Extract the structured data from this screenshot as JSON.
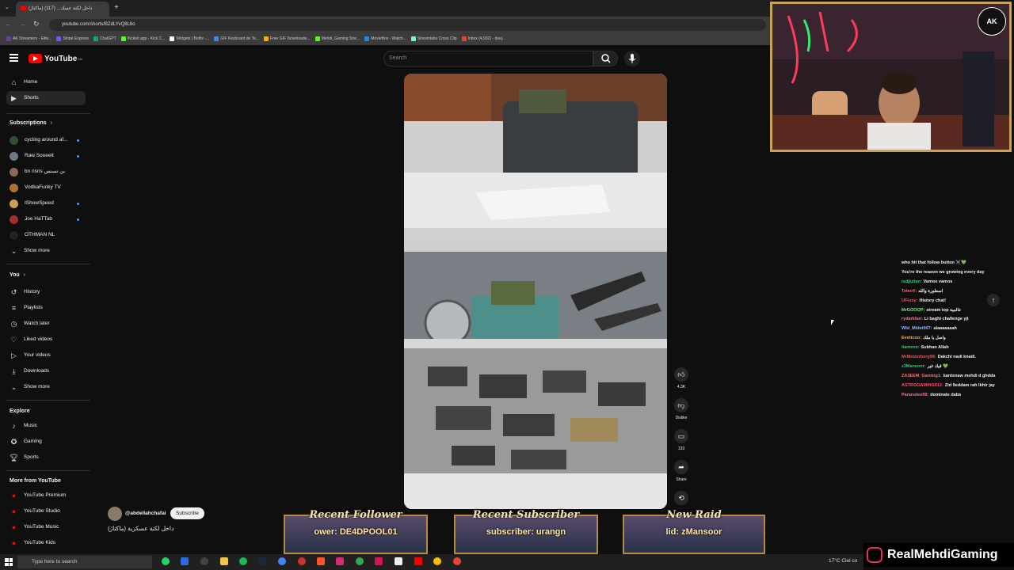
{
  "browser": {
    "tab_title": "(ماكتاژ) داخل لكتة عسك... (117)",
    "url": "youtube.com/shorts/BZdLYvQ8L6o",
    "bookmarks": [
      "AK Streamers - Elite...",
      "Stripe Express",
      "ChatGPT",
      "Kicklet.app - Kick C...",
      "Widgets | Botfix -...",
      "GIF Keyboard de Te...",
      "Free GIF Downloade...",
      "Mehdi_Gaming Stre...",
      "MovieBox - Watch...",
      "Streamlabs Cross Clip",
      "Inbox (4,932) - deej..."
    ],
    "bookmark_colors": [
      "#6b3fa0",
      "#635bff",
      "#10a37f",
      "#53fc18",
      "#ffffff",
      "#4285f4",
      "#f4b400",
      "#53fc18",
      "#1e88e5",
      "#80f5d2",
      "#ea4335"
    ]
  },
  "youtube": {
    "logo_text": "YouTube",
    "logo_sup": "MA",
    "search_placeholder": "Search",
    "sidebar": {
      "main": [
        {
          "label": "Home",
          "icon": "home-icon"
        },
        {
          "label": "Shorts",
          "icon": "shorts-icon"
        }
      ],
      "subscriptions_title": "Subscriptions",
      "subscriptions": [
        {
          "label": "cycling around af...",
          "color": "#2f4f2f",
          "dot": true
        },
        {
          "label": "Raw Soueeit",
          "color": "#6a7a8a",
          "dot": true
        },
        {
          "label": "bn nsns بن نسنس",
          "color": "#8a6a5a",
          "dot": false
        },
        {
          "label": "VodkaFunky TV",
          "color": "#b07030",
          "dot": false
        },
        {
          "label": "IShowSpeed",
          "color": "#c9a24a",
          "dot": true
        },
        {
          "label": "Joe HaTTab",
          "color": "#a03030",
          "dot": true
        },
        {
          "label": "OTHMAN NL",
          "color": "#222222",
          "dot": false
        }
      ],
      "show_more": "Show more",
      "you_title": "You",
      "you": [
        {
          "label": "History",
          "icon": "history-icon"
        },
        {
          "label": "Playlists",
          "icon": "playlists-icon"
        },
        {
          "label": "Watch later",
          "icon": "watch-later-icon"
        },
        {
          "label": "Liked videos",
          "icon": "liked-videos-icon"
        },
        {
          "label": "Your videos",
          "icon": "your-videos-icon"
        },
        {
          "label": "Downloads",
          "icon": "downloads-icon"
        }
      ],
      "show_more_2": "Show more",
      "explore_title": "Explore",
      "explore": [
        {
          "label": "Music",
          "icon": "music-icon"
        },
        {
          "label": "Gaming",
          "icon": "gaming-icon"
        },
        {
          "label": "Sports",
          "icon": "sports-icon"
        }
      ],
      "more_title": "More from YouTube",
      "more": [
        {
          "label": "YouTube Premium"
        },
        {
          "label": "YouTube Studio"
        },
        {
          "label": "YouTube Music"
        },
        {
          "label": "YouTube Kids"
        }
      ]
    },
    "short": {
      "channel": "@abdellahchafai",
      "subscribe": "Subscribe",
      "title": "(ماكتاژ) داخل لكتة عسكرية",
      "likes": "4.3K",
      "dislike": "Dislike",
      "comments": "133",
      "share": "Share"
    }
  },
  "stream": {
    "chat": [
      {
        "user": "",
        "text": "who hit that follow button ⚔️💚",
        "color": "#ffffff"
      },
      {
        "user": "",
        "text": "You're the reason we growing every day",
        "color": "#ffffff"
      },
      {
        "user": "isdjjulian:",
        "text": "Vamos vamos",
        "color": "#2ecc71"
      },
      {
        "user": "TeleoY:",
        "text": "اسطورة والله",
        "color": "#ff6b6b"
      },
      {
        "user": "UFluoy:",
        "text": "History chat!",
        "color": "#ff4d4d"
      },
      {
        "user": "MrGOOOP:",
        "text": "stream top عالمية",
        "color": "#7ee787"
      },
      {
        "user": "rydarkfan:",
        "text": "Li baghi challenge yji",
        "color": "#ff6b9d"
      },
      {
        "user": "Wld_Midet007:",
        "text": "alaaaaaaah",
        "color": "#9ab7ff"
      },
      {
        "user": "Evettcoo:",
        "text": "واصل يا ملك",
        "color": "#ffa94d"
      },
      {
        "user": "itamemi:",
        "text": "Subhan Allah",
        "color": "#2ecc71"
      },
      {
        "user": "MrMeizerberg98:",
        "text": "Dakchi nadi knadi.",
        "color": "#ff4d4d"
      },
      {
        "user": "z3Mansoor:",
        "text": "قيك غير 💚",
        "color": "#2ecc71"
      },
      {
        "user": "ZA3EEM_Gaming1:",
        "text": "kantsnaw mehdi d ghdda",
        "color": "#ff6b6b"
      },
      {
        "user": "ASTROGAMING012:",
        "text": "Zid 9eddam rah lkhir jay",
        "color": "#ff4d6d"
      },
      {
        "user": "Paranolee99:",
        "text": "dominate daba",
        "color": "#ff6b9d"
      }
    ],
    "recent_follower_title": "Recent Follower",
    "recent_follower_value": "ower: DE4DPOOL01",
    "recent_subscriber_title": "Recent Subscriber",
    "recent_subscriber_value": "subscriber: urangn",
    "new_raid_title": "New Raid",
    "new_raid_value": "lid: zMansoor",
    "brand": "RealMehdiGaming"
  },
  "taskbar": {
    "search_placeholder": "Type here to search",
    "weather": "17°C Ciel co"
  }
}
